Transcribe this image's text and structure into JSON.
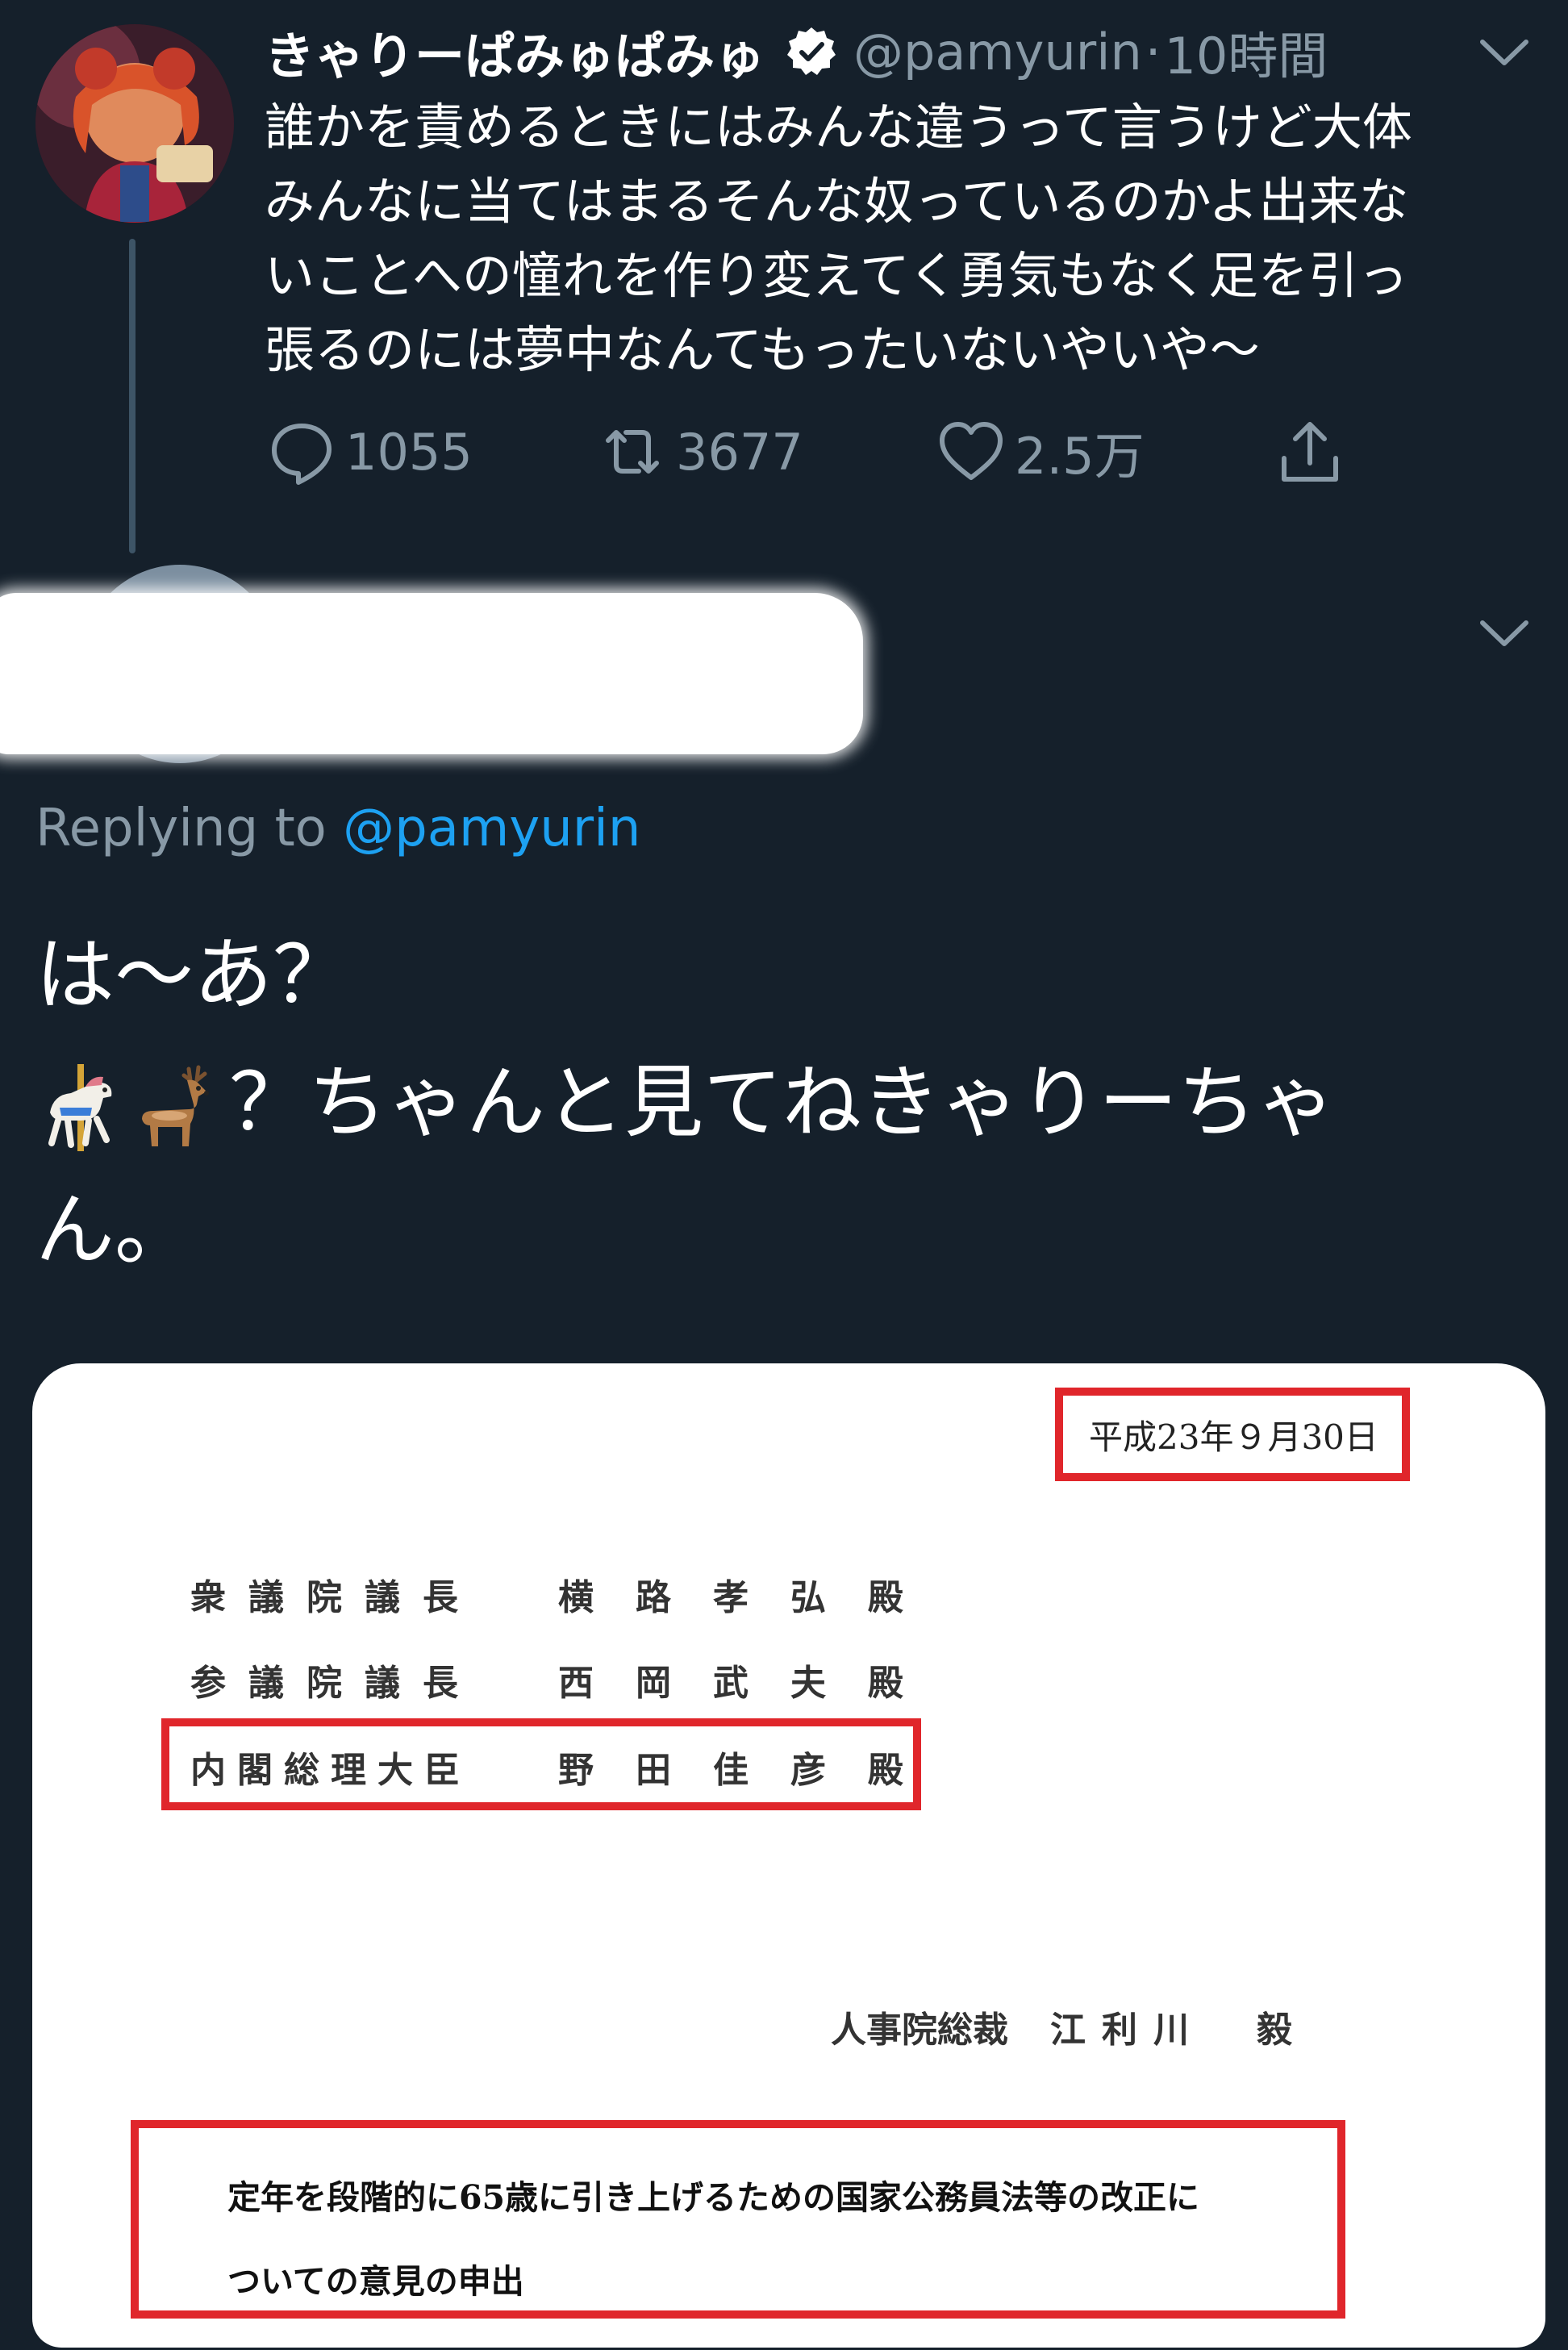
{
  "tweet": {
    "display_name": "きゃりーぱみゅぱみゅ",
    "handle": "@pamyurin",
    "separator": "·",
    "time": "10時間",
    "text_lines": [
      "誰かを責めるときにはみんな違うって言うけど大体",
      "みんなに当てはまるそんな奴っているのかよ出来な",
      "いことへの憧れを作り変えてく勇気もなく足を引っ",
      "張るのには夢中なんてもったいないやいや〜"
    ],
    "replies": "1055",
    "retweets": "3677",
    "likes": "2.5万"
  },
  "reply": {
    "replying_prefix": "Replying to ",
    "replying_mention": "@pamyurin",
    "line1": "は〜あ？",
    "line2_text": "？ちゃんと見てねきゃりーちゃ",
    "line3": "ん。",
    "emojis": [
      "carousel-horse-icon",
      "deer-icon"
    ]
  },
  "document": {
    "date": "平成23年９月30日",
    "addressees": [
      {
        "title": "衆議院議長",
        "name": "横路孝弘殿"
      },
      {
        "title": "参議院議長",
        "name": "西岡武夫殿"
      },
      {
        "title": "内閣総理大臣",
        "name": "野田佳彦殿"
      }
    ],
    "sender_title": "人事院総裁",
    "sender_name": "江利川　毅",
    "subject_line1": "定年を段階的に65歳に引き上げるための国家公務員法等の改正に",
    "subject_line2": "ついての意見の申出"
  },
  "colors": {
    "background": "#15202b",
    "secondary_text": "#8899a6",
    "link": "#1da1f2",
    "highlight_box": "#e0262b"
  }
}
